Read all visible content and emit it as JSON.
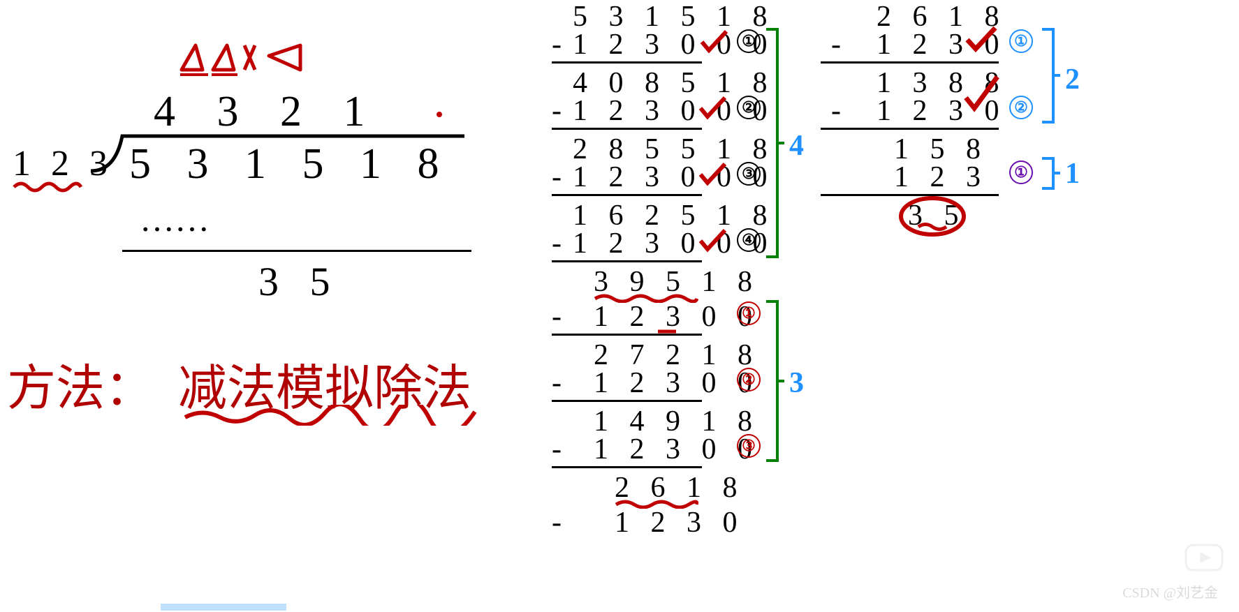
{
  "division": {
    "quotient": "4 3 2 1",
    "divisor": "1 2 3",
    "dividend": "5 3 1 5 1 8",
    "ellipsis": "……",
    "remainder": "3 5"
  },
  "method": {
    "label": "方法：",
    "content": "减法模拟除法"
  },
  "colA": {
    "l1": "5 3 1 5 1 8",
    "l2": "1 2 3 0 0 0",
    "l3": "4 0 8 5 1 8",
    "l4": "1 2 3 0 0 0",
    "l5": "2 8 5 5 1 8",
    "l6": "1 2 3 0 0 0",
    "l7": "1 6 2 5 1 8",
    "l8": "1 2 3 0 0 0",
    "l9": "3 9 5 1 8",
    "l10": "1 2 3 0 0",
    "l11": "2 7 2 1 8",
    "l12": "1 2 3 0 0",
    "l13": "1 4 9 1 8",
    "l14": "1 2 3 0 0",
    "l15": "2 6 1 8",
    "l16": "1 2 3 0",
    "c1": "①",
    "c2": "②",
    "c3": "③",
    "c4": "④",
    "r1": "①",
    "r2": "②",
    "r3": "③",
    "bracketA": "4",
    "bracketB": "3"
  },
  "colB": {
    "l1": "2 6 1 8",
    "l2": "1 2 3 0",
    "l3": "1 3 8 8",
    "l4": "1 2 3 0",
    "l5": "1 5 8",
    "l6": "1 2 3",
    "l7": "3 5",
    "c1": "①",
    "c2": "②",
    "c3": "①",
    "bracketA": "2",
    "bracketB": "1"
  },
  "watermark": "CSDN @刘艺金"
}
